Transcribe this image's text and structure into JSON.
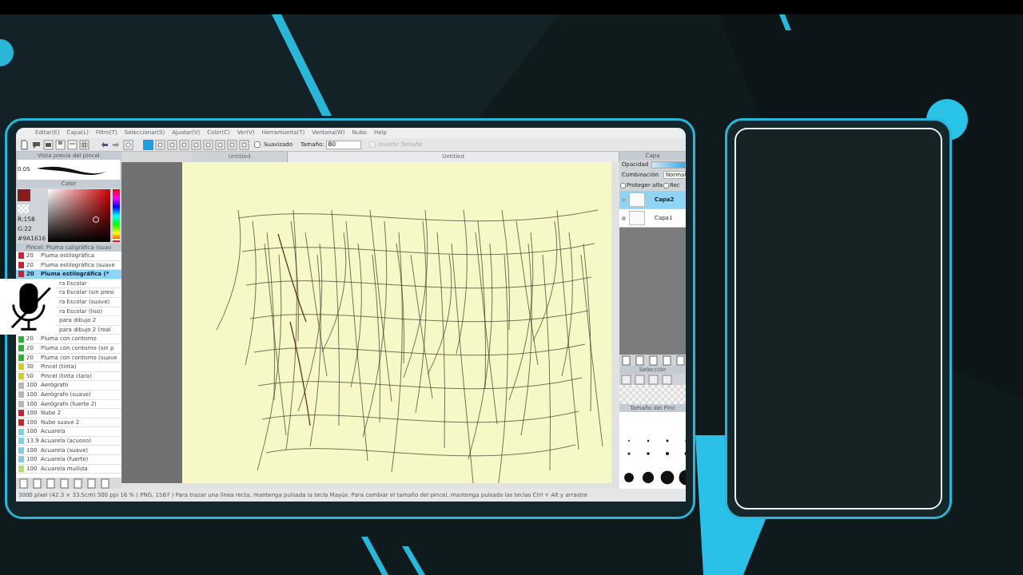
{
  "menu": [
    "Editar(E)",
    "Capa(L)",
    "Filtro(T)",
    "Seleccionar(S)",
    "Ajustar(V)",
    "Color(C)",
    "Ver(V)",
    "Herramienta(T)",
    "Ventana(W)",
    "Nubo",
    "Help"
  ],
  "toolbar": {
    "antialias": {
      "label": "Suavizado",
      "checked": false
    },
    "size_label": "Tamaño:",
    "size_value": "80",
    "invert": {
      "label": "Invertir Tamaño",
      "disabled": true
    }
  },
  "brush_preview": {
    "title": "Vista previa del pincel",
    "size": "0.05"
  },
  "color_panel": {
    "title": "Color",
    "values": [
      "R:158",
      "G:22",
      "#9A1616"
    ],
    "hue": {
      "level": 0.97
    }
  },
  "brush_list": {
    "title": "Pincel: Pluma caligráfica (suav",
    "items": [
      {
        "kind": "brush",
        "color": "#d02030",
        "size": "20",
        "name": "Pluma estilográfica",
        "selected": false
      },
      {
        "kind": "brush",
        "color": "#d02030",
        "size": "20",
        "name": "Pluma estilográfica (suave",
        "selected": false
      },
      {
        "kind": "brush",
        "color": "#d02030",
        "size": "20",
        "name": "Pluma estilográfica (*",
        "selected": true
      },
      {
        "kind": "covered",
        "name": "ra Escolar",
        "selected": false
      },
      {
        "kind": "covered",
        "name": "ra Escolar (sin presi",
        "selected": false
      },
      {
        "kind": "covered",
        "name": "ra Escolar (suave)",
        "selected": false
      },
      {
        "kind": "covered",
        "name": "ra Escolar (liso)",
        "selected": false
      },
      {
        "kind": "covered",
        "name": "para dibujo 2",
        "selected": false
      },
      {
        "kind": "covered",
        "name": "para dibujo 2 (real",
        "selected": false
      },
      {
        "kind": "brush",
        "color": "#30b030",
        "size": "20",
        "name": "Pluma con contorno",
        "selected": false
      },
      {
        "kind": "brush",
        "color": "#30b030",
        "size": "20",
        "name": "Pluma con contorno (sin p",
        "selected": false
      },
      {
        "kind": "brush",
        "color": "#30b030",
        "size": "20",
        "name": "Pluma con contorno (suave",
        "selected": false
      },
      {
        "kind": "brush",
        "color": "#d0d020",
        "size": "30",
        "name": "Pincel (tinta)",
        "selected": false
      },
      {
        "kind": "brush",
        "color": "#d0d020",
        "size": "50",
        "name": "Pincel (tinta clara)",
        "selected": false
      },
      {
        "kind": "brush",
        "color": "#b8b8b8",
        "size": "100",
        "name": "Aerógrafo",
        "selected": false
      },
      {
        "kind": "brush",
        "color": "#b8b8b8",
        "size": "100",
        "name": "Aerógrafo (suave)",
        "selected": false
      },
      {
        "kind": "brush",
        "color": "#b8b8b8",
        "size": "100",
        "name": "Aerógrafo (fuerte 2)",
        "selected": false
      },
      {
        "kind": "brush",
        "color": "#d02030",
        "size": "100",
        "name": "Nube 2",
        "selected": false
      },
      {
        "kind": "brush",
        "color": "#d02030",
        "size": "100",
        "name": "Nube suave 2",
        "selected": false
      },
      {
        "kind": "brush",
        "color": "#80d0e0",
        "size": "100",
        "name": "Acuarela",
        "selected": false
      },
      {
        "kind": "brush",
        "color": "#80d0e0",
        "size": "13.9",
        "name": "Acuarela (acuoso)",
        "selected": false
      },
      {
        "kind": "brush",
        "color": "#80d0e0",
        "size": "100",
        "name": "Acuarela (suave)",
        "selected": false
      },
      {
        "kind": "brush",
        "color": "#80d0e0",
        "size": "100",
        "name": "Acuarela (fuerte)",
        "selected": false
      },
      {
        "kind": "brush",
        "color": "#b0e060",
        "size": "100",
        "name": "Acuarela mullida",
        "selected": false
      }
    ]
  },
  "canvas_tabs": [
    {
      "label": "Untitled",
      "selected": false
    },
    {
      "label": "Untitled",
      "selected": true
    }
  ],
  "layers_panel": {
    "title": "Capa",
    "opacity_label": "Opacidad",
    "opacity": {
      "level": 1
    },
    "blend_label": "Combinación:",
    "blend_value": "Normal",
    "options": [
      {
        "label": "Proteger alfa",
        "checked": false
      },
      {
        "label": "Rec",
        "checked": false
      }
    ],
    "layers": [
      {
        "name": "Capa2",
        "selected": true
      },
      {
        "name": "Capa1",
        "selected": false
      }
    ]
  },
  "selection_panel": {
    "title": "Selección"
  },
  "brush_size_panel": {
    "title": "Tamaño del Pinc"
  },
  "status_bar": "3000 píxel  (42.3 × 33.5cm)  300 ppi  16 %  ( PNG, 1587 )  Para trazar una línea recta, mantenga pulsada la tecla Mayús. Para cambiar el tamaño del pincel, mantenga pulsada las teclas Ctrl + Alt y arrastre"
}
